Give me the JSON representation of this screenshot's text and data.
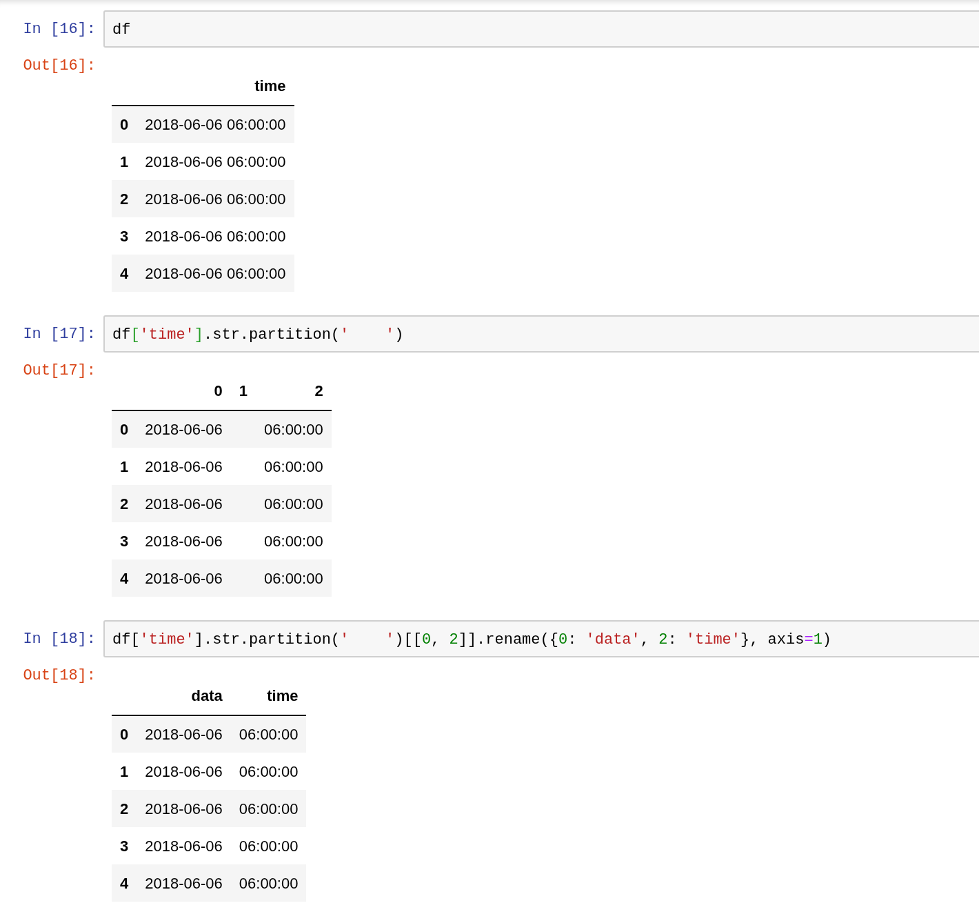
{
  "cells": [
    {
      "in_prompt": "In [16]:",
      "code": [
        {
          "kind": "plain",
          "text": "df"
        }
      ],
      "out_prompt": "Out[16]:",
      "table": {
        "columns": [
          "time"
        ],
        "rows": [
          {
            "index": "0",
            "cells": [
              "2018-06-06 06:00:00"
            ]
          },
          {
            "index": "1",
            "cells": [
              "2018-06-06 06:00:00"
            ]
          },
          {
            "index": "2",
            "cells": [
              "2018-06-06 06:00:00"
            ]
          },
          {
            "index": "3",
            "cells": [
              "2018-06-06 06:00:00"
            ]
          },
          {
            "index": "4",
            "cells": [
              "2018-06-06 06:00:00"
            ]
          }
        ]
      }
    },
    {
      "in_prompt": "In [17]:",
      "code": [
        {
          "kind": "plain",
          "text": "df"
        },
        {
          "kind": "bracket",
          "text": "["
        },
        {
          "kind": "string",
          "text": "'time'"
        },
        {
          "kind": "bracket",
          "text": "]"
        },
        {
          "kind": "plain",
          "text": ".str.partition("
        },
        {
          "kind": "string",
          "text": "'    '"
        },
        {
          "kind": "plain",
          "text": ")"
        }
      ],
      "out_prompt": "Out[17]:",
      "table": {
        "columns": [
          "0",
          "1",
          "2"
        ],
        "rows": [
          {
            "index": "0",
            "cells": [
              "2018-06-06",
              null,
              "06:00:00"
            ]
          },
          {
            "index": "1",
            "cells": [
              "2018-06-06",
              null,
              "06:00:00"
            ]
          },
          {
            "index": "2",
            "cells": [
              "2018-06-06",
              null,
              "06:00:00"
            ]
          },
          {
            "index": "3",
            "cells": [
              "2018-06-06",
              null,
              "06:00:00"
            ]
          },
          {
            "index": "4",
            "cells": [
              "2018-06-06",
              null,
              "06:00:00"
            ]
          }
        ]
      }
    },
    {
      "in_prompt": "In [18]:",
      "code": [
        {
          "kind": "plain",
          "text": "df["
        },
        {
          "kind": "string",
          "text": "'time'"
        },
        {
          "kind": "plain",
          "text": "].str.partition("
        },
        {
          "kind": "string",
          "text": "'    '"
        },
        {
          "kind": "plain",
          "text": ")[["
        },
        {
          "kind": "number",
          "text": "0"
        },
        {
          "kind": "plain",
          "text": ", "
        },
        {
          "kind": "number",
          "text": "2"
        },
        {
          "kind": "plain",
          "text": "]].rename({"
        },
        {
          "kind": "number",
          "text": "0"
        },
        {
          "kind": "plain",
          "text": ": "
        },
        {
          "kind": "string",
          "text": "'data'"
        },
        {
          "kind": "plain",
          "text": ", "
        },
        {
          "kind": "number",
          "text": "2"
        },
        {
          "kind": "plain",
          "text": ": "
        },
        {
          "kind": "string",
          "text": "'time'"
        },
        {
          "kind": "plain",
          "text": "}, axis"
        },
        {
          "kind": "operator",
          "text": "="
        },
        {
          "kind": "number",
          "text": "1"
        },
        {
          "kind": "plain",
          "text": ")"
        }
      ],
      "out_prompt": "Out[18]:",
      "table": {
        "columns": [
          "data",
          "time"
        ],
        "rows": [
          {
            "index": "0",
            "cells": [
              "2018-06-06",
              "06:00:00"
            ]
          },
          {
            "index": "1",
            "cells": [
              "2018-06-06",
              "06:00:00"
            ]
          },
          {
            "index": "2",
            "cells": [
              "2018-06-06",
              "06:00:00"
            ]
          },
          {
            "index": "3",
            "cells": [
              "2018-06-06",
              "06:00:00"
            ]
          },
          {
            "index": "4",
            "cells": [
              "2018-06-06",
              "06:00:00"
            ]
          }
        ]
      }
    }
  ]
}
